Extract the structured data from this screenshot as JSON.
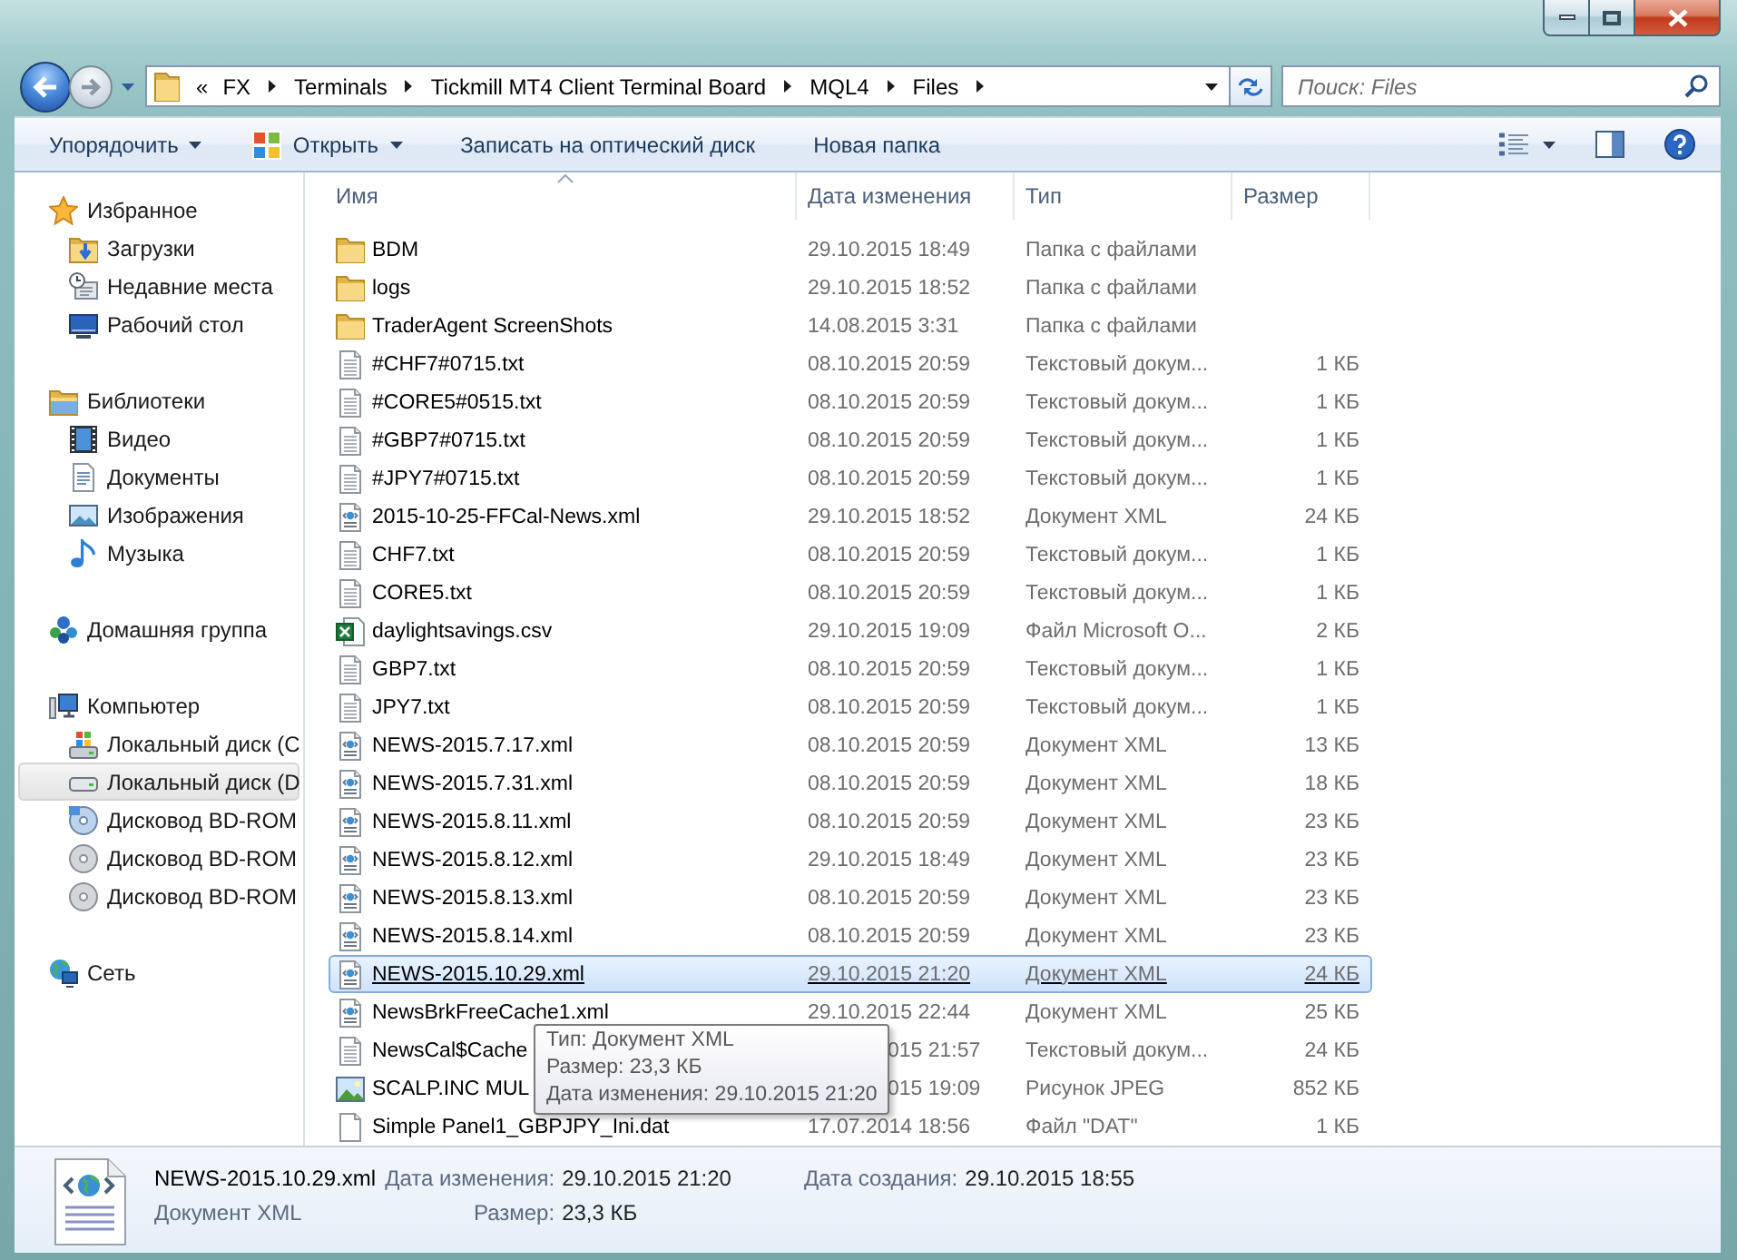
{
  "address_bar": {
    "overflow": "«",
    "path": [
      "FX",
      "Terminals",
      "Tickmill MT4 Client Terminal Board",
      "MQL4",
      "Files"
    ]
  },
  "search": {
    "placeholder": "Поиск: Files"
  },
  "toolbar": {
    "items": [
      {
        "label": "Упорядочить",
        "kind": "text",
        "dropdown": true
      },
      {
        "label": "Открыть",
        "kind": "icon",
        "dropdown": true
      },
      {
        "label": "Записать на оптический диск",
        "kind": "text",
        "dropdown": false
      },
      {
        "label": "Новая папка",
        "kind": "text",
        "dropdown": false
      }
    ]
  },
  "sidebar": {
    "groups": [
      {
        "label": "Избранное",
        "kind": "favorites",
        "selected": false,
        "children": [
          {
            "label": "Загрузки",
            "kind": "downloads",
            "selected": false
          },
          {
            "label": "Недавние места",
            "kind": "recent",
            "selected": false
          },
          {
            "label": "Рабочий стол",
            "kind": "desktop",
            "selected": false
          }
        ]
      },
      {
        "label": "Библиотеки",
        "kind": "libraries",
        "selected": false,
        "children": [
          {
            "label": "Видео",
            "kind": "video",
            "selected": false
          },
          {
            "label": "Документы",
            "kind": "documents",
            "selected": false
          },
          {
            "label": "Изображения",
            "kind": "pictures",
            "selected": false
          },
          {
            "label": "Музыка",
            "kind": "music",
            "selected": false
          }
        ]
      },
      {
        "label": "Домашняя группа",
        "kind": "homegroup",
        "selected": false
      },
      {
        "label": "Компьютер",
        "kind": "computer",
        "selected": false,
        "children": [
          {
            "label": "Локальный диск (C",
            "kind": "system_disk",
            "selected": false
          },
          {
            "label": "Локальный диск (D",
            "kind": "disk",
            "selected": true
          },
          {
            "label": "Дисковод BD-ROM",
            "kind": "optical_media",
            "selected": false
          },
          {
            "label": "Дисковод BD-ROM",
            "kind": "optical",
            "selected": false
          },
          {
            "label": "Дисковод BD-ROM",
            "kind": "optical",
            "selected": false
          }
        ]
      },
      {
        "label": "Сеть",
        "kind": "network",
        "selected": false
      }
    ]
  },
  "columns": [
    {
      "label": "Имя",
      "sorted": true
    },
    {
      "label": "Дата изменения",
      "sorted": false
    },
    {
      "label": "Тип",
      "sorted": false
    },
    {
      "label": "Размер",
      "sorted": false
    }
  ],
  "rows": [
    {
      "kind": "folder",
      "name": "BDM",
      "date": "29.10.2015 18:49",
      "type": "Папка с файлами",
      "selected": false,
      "covered": false
    },
    {
      "kind": "folder",
      "name": "logs",
      "date": "29.10.2015 18:52",
      "type": "Папка с файлами",
      "selected": false,
      "covered": false
    },
    {
      "kind": "folder",
      "name": "TraderAgent ScreenShots",
      "date": "14.08.2015 3:31",
      "type": "Папка с файлами",
      "selected": false,
      "covered": false
    },
    {
      "kind": "text",
      "name": "#CHF7#0715.txt",
      "date": "08.10.2015 20:59",
      "type": "Текстовый докум...",
      "size": "1 КБ",
      "selected": false,
      "covered": false
    },
    {
      "kind": "text",
      "name": "#CORE5#0515.txt",
      "date": "08.10.2015 20:59",
      "type": "Текстовый докум...",
      "size": "1 КБ",
      "selected": false,
      "covered": false
    },
    {
      "kind": "text",
      "name": "#GBP7#0715.txt",
      "date": "08.10.2015 20:59",
      "type": "Текстовый докум...",
      "size": "1 КБ",
      "selected": false,
      "covered": false
    },
    {
      "kind": "text",
      "name": "#JPY7#0715.txt",
      "date": "08.10.2015 20:59",
      "type": "Текстовый докум...",
      "size": "1 КБ",
      "selected": false,
      "covered": false
    },
    {
      "kind": "xml",
      "name": "2015-10-25-FFCal-News.xml",
      "date": "29.10.2015 18:52",
      "type": "Документ XML",
      "size": "24 КБ",
      "selected": false,
      "covered": false
    },
    {
      "kind": "text",
      "name": "CHF7.txt",
      "date": "08.10.2015 20:59",
      "type": "Текстовый докум...",
      "size": "1 КБ",
      "selected": false,
      "covered": false
    },
    {
      "kind": "text",
      "name": "CORE5.txt",
      "date": "08.10.2015 20:59",
      "type": "Текстовый докум...",
      "size": "1 КБ",
      "selected": false,
      "covered": false
    },
    {
      "kind": "spreadsheet",
      "name": "daylightsavings.csv",
      "date": "29.10.2015 19:09",
      "type": "Файл Microsoft O...",
      "size": "2 КБ",
      "selected": false,
      "covered": false
    },
    {
      "kind": "text",
      "name": "GBP7.txt",
      "date": "08.10.2015 20:59",
      "type": "Текстовый докум...",
      "size": "1 КБ",
      "selected": false,
      "covered": false
    },
    {
      "kind": "text",
      "name": "JPY7.txt",
      "date": "08.10.2015 20:59",
      "type": "Текстовый докум...",
      "size": "1 КБ",
      "selected": false,
      "covered": false
    },
    {
      "kind": "xml",
      "name": "NEWS-2015.7.17.xml",
      "date": "08.10.2015 20:59",
      "type": "Документ XML",
      "size": "13 КБ",
      "selected": false,
      "covered": false
    },
    {
      "kind": "xml",
      "name": "NEWS-2015.7.31.xml",
      "date": "08.10.2015 20:59",
      "type": "Документ XML",
      "size": "18 КБ",
      "selected": false,
      "covered": false
    },
    {
      "kind": "xml",
      "name": "NEWS-2015.8.11.xml",
      "date": "08.10.2015 20:59",
      "type": "Документ XML",
      "size": "23 КБ",
      "selected": false,
      "covered": false
    },
    {
      "kind": "xml",
      "name": "NEWS-2015.8.12.xml",
      "date": "29.10.2015 18:49",
      "type": "Документ XML",
      "size": "23 КБ",
      "selected": false,
      "covered": false
    },
    {
      "kind": "xml",
      "name": "NEWS-2015.8.13.xml",
      "date": "08.10.2015 20:59",
      "type": "Документ XML",
      "size": "23 КБ",
      "selected": false,
      "covered": false
    },
    {
      "kind": "xml",
      "name": "NEWS-2015.8.14.xml",
      "date": "08.10.2015 20:59",
      "type": "Документ XML",
      "size": "23 КБ",
      "selected": false,
      "covered": false
    },
    {
      "kind": "xml",
      "name": "NEWS-2015.10.29.xml",
      "date": "29.10.2015 21:20",
      "type": "Документ XML",
      "size": "24 КБ",
      "selected": true,
      "covered": false
    },
    {
      "kind": "xml",
      "name": "NewsBrkFreeCache1.xml",
      "date": "29.10.2015 22:44",
      "type": "Документ XML",
      "size": "25 КБ",
      "selected": false,
      "covered": false
    },
    {
      "kind": "text",
      "name": "NewsCal$Cache",
      "date": "015 21:57",
      "type": "Текстовый докум...",
      "size": "24 КБ",
      "selected": false,
      "covered": true
    },
    {
      "kind": "image",
      "name": "SCALP.INC MUL",
      "date": "015 19:09",
      "type": "Рисунок JPEG",
      "size": "852 КБ",
      "selected": false,
      "covered": true
    },
    {
      "kind": "blank",
      "name": "Simple Panel1_GBPJPY_Ini.dat",
      "date": "17.07.2014 18:56",
      "type": "Файл \"DAT\"",
      "size": "1 КБ",
      "selected": false,
      "covered": false
    }
  ],
  "tooltip": {
    "lines": [
      "Тип: Документ XML",
      "Размер: 23,3 КБ",
      "Дата изменения: 29.10.2015 21:20"
    ]
  },
  "details": {
    "kind": "xml",
    "name": "NEWS-2015.10.29.xml",
    "type": "Документ XML",
    "columns": [
      [
        {
          "label": "Дата изменения:",
          "value": "29.10.2015 21:20"
        },
        {
          "label": "Размер:",
          "value": "23,3 КБ"
        }
      ],
      [
        {
          "label": "Дата создания:",
          "value": "29.10.2015 18:55"
        }
      ]
    ]
  }
}
